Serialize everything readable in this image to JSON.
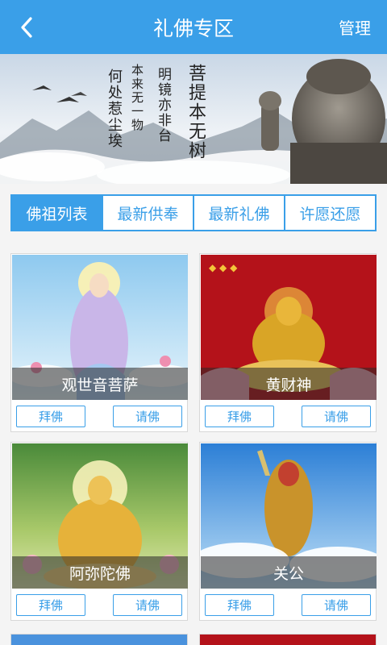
{
  "header": {
    "title": "礼佛专区",
    "manage_label": "管理",
    "back_icon": "chevron-left-icon",
    "bg_color": "#3a9fe8"
  },
  "banner": {
    "poem_col1": "菩提本无树",
    "poem_col2": "明镜亦非台",
    "poem_col3": "本来无一物",
    "poem_col4": "何处惹尘埃"
  },
  "tabs": [
    {
      "label": "佛祖列表",
      "active": true
    },
    {
      "label": "最新供奉",
      "active": false
    },
    {
      "label": "最新礼佛",
      "active": false
    },
    {
      "label": "许愿还愿",
      "active": false
    }
  ],
  "cards": [
    {
      "name": "观世音菩萨",
      "worship_label": "拜佛",
      "invite_label": "请佛"
    },
    {
      "name": "黄财神",
      "worship_label": "拜佛",
      "invite_label": "请佛"
    },
    {
      "name": "阿弥陀佛",
      "worship_label": "拜佛",
      "invite_label": "请佛"
    },
    {
      "name": "关公",
      "worship_label": "拜佛",
      "invite_label": "请佛"
    }
  ]
}
